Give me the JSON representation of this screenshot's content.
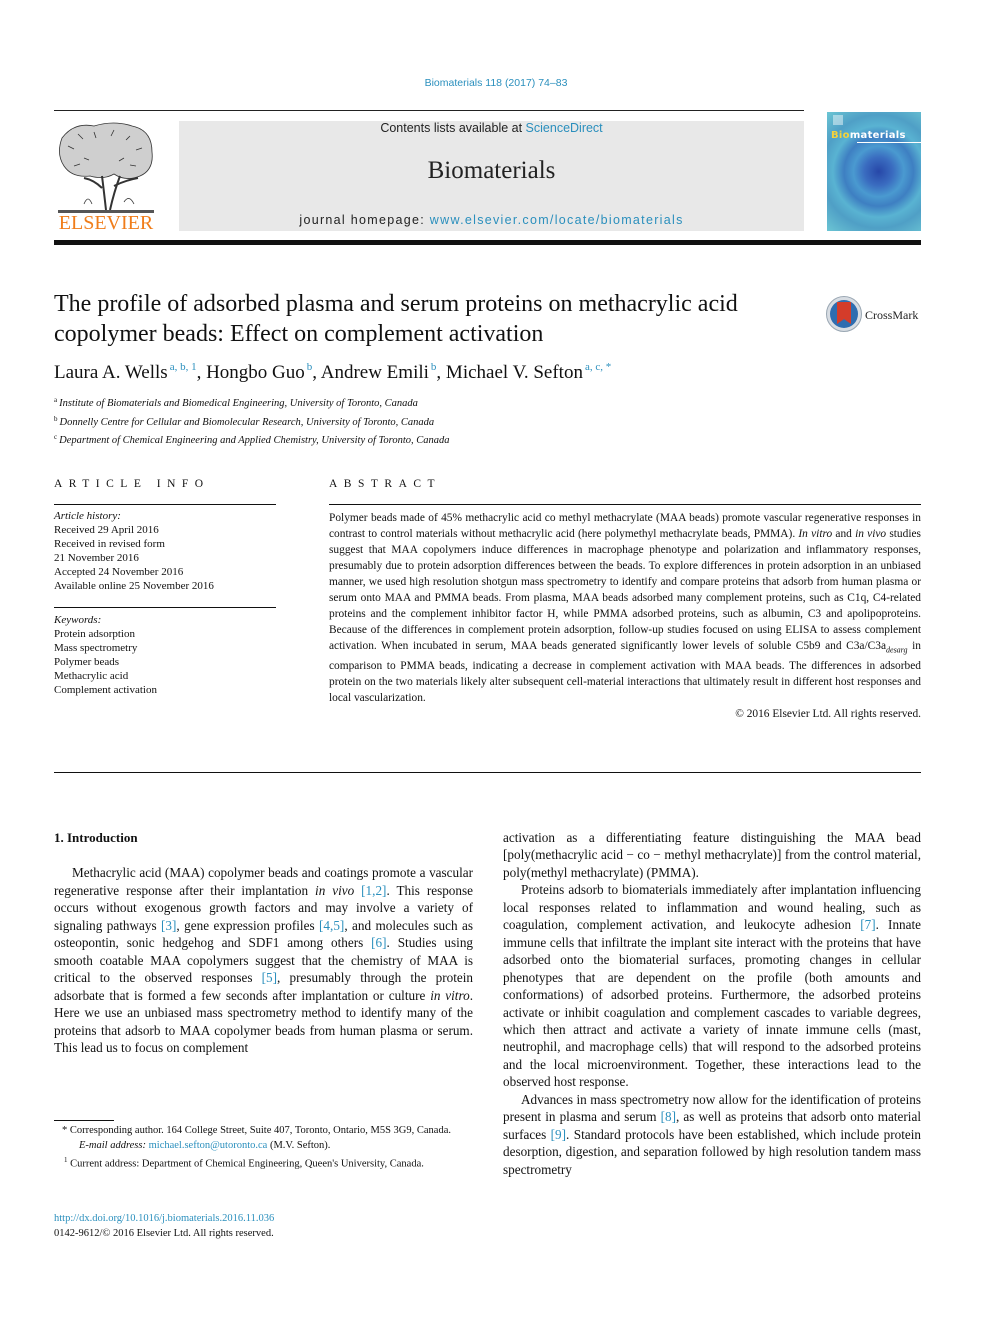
{
  "header": {
    "journal_ref": "Biomaterials 118 (2017) 74–83",
    "contents_prefix": "Contents lists available at ",
    "contents_link": "ScienceDirect",
    "journal_name": "Biomaterials",
    "homepage_prefix": "journal homepage: ",
    "homepage_link": "www.elsevier.com/locate/biomaterials",
    "publisher_logo_text": "ELSEVIER",
    "cover_title_bio": "Bio",
    "cover_title_rest": "materials",
    "colors": {
      "link": "#2a8fbd",
      "elsevier_orange": "#f07d1a",
      "masthead_bg": "#e8e8e8"
    }
  },
  "article": {
    "title": "The profile of adsorbed plasma and serum proteins on methacrylic acid copolymer beads: Effect on complement activation",
    "crossmark_label": "CrossMark",
    "authors": [
      {
        "name": "Laura A. Wells",
        "sup": "a, b, 1",
        "sep": ", "
      },
      {
        "name": "Hongbo Guo",
        "sup": "b",
        "sep": ", "
      },
      {
        "name": "Andrew Emili",
        "sup": "b",
        "sep": ", "
      },
      {
        "name": "Michael V. Sefton",
        "sup": "a, c, *",
        "sep": ""
      }
    ],
    "affiliations": [
      {
        "mark": "a",
        "text": "Institute of Biomaterials and Biomedical Engineering, University of Toronto, Canada"
      },
      {
        "mark": "b",
        "text": "Donnelly Centre for Cellular and Biomolecular Research, University of Toronto, Canada"
      },
      {
        "mark": "c",
        "text": "Department of Chemical Engineering and Applied Chemistry, University of Toronto, Canada"
      }
    ]
  },
  "article_info": {
    "heading": "ARTICLE INFO",
    "history_label": "Article history:",
    "history": [
      "Received 29 April 2016",
      "Received in revised form",
      "21 November 2016",
      "Accepted 24 November 2016",
      "Available online 25 November 2016"
    ],
    "keywords_label": "Keywords:",
    "keywords": [
      "Protein adsorption",
      "Mass spectrometry",
      "Polymer beads",
      "Methacrylic acid",
      "Complement activation"
    ]
  },
  "abstract": {
    "heading": "ABSTRACT",
    "part1": "Polymer beads made of 45% methacrylic acid co methyl methacrylate (MAA beads) promote vascular regenerative responses in contrast to control materials without methacrylic acid (here polymethyl methacrylate beads, PMMA). ",
    "in_vitro": "In vitro",
    "and": " and ",
    "in_vivo": "in vivo",
    "part2": " studies suggest that MAA copolymers induce differences in macrophage phenotype and polarization and inflammatory responses, presumably due to protein adsorption differences between the beads. To explore differences in protein adsorption in an unbiased manner, we used high resolution shotgun mass spectrometry to identify and compare proteins that adsorb from human plasma or serum onto MAA and PMMA beads. From plasma, MAA beads adsorbed many complement proteins, such as C1q, C4-related proteins and the complement inhibitor factor H, while PMMA adsorbed proteins, such as albumin, C3 and apolipoproteins. Because of the differences in complement protein adsorption, follow-up studies focused on using ELISA to assess complement activation. When incubated in serum, MAA beads generated significantly lower levels of soluble C5b9 and C3a/C3a",
    "sub": "desarg",
    "part3": " in comparison to PMMA beads, indicating a decrease in complement activation with MAA beads. The differences in adsorbed protein on the two materials likely alter subsequent cell-material interactions that ultimately result in different host responses and local vascularization.",
    "copyright": "© 2016 Elsevier Ltd. All rights reserved."
  },
  "intro": {
    "heading": "1.  Introduction",
    "p1": [
      {
        "t": "Methacrylic acid (MAA) copolymer beads and coatings promote a vascular regenerative response after their implantation "
      },
      {
        "i": "in vivo"
      },
      {
        "t": " "
      },
      {
        "ref": "[1,2]"
      },
      {
        "t": ". This response occurs without exogenous growth factors and may involve a variety of signaling pathways "
      },
      {
        "ref": "[3]"
      },
      {
        "t": ", gene expression profiles "
      },
      {
        "ref": "[4,5]"
      },
      {
        "t": ", and molecules such as osteopontin, sonic hedgehog and SDF1 among others "
      },
      {
        "ref": "[6]"
      },
      {
        "t": ". Studies using smooth coatable MAA copolymers suggest that the chemistry of MAA is critical to the observed responses "
      },
      {
        "ref": "[5]"
      },
      {
        "t": ", presumably through the protein adsorbate that is formed a few seconds after implantation or culture "
      },
      {
        "i": "in vitro"
      },
      {
        "t": ". Here we use an unbiased mass spectrometry method to identify many of the proteins that adsorb to MAA copolymer beads from human plasma or serum. This lead us to focus on complement"
      }
    ],
    "p1_cont": "activation as a differentiating feature distinguishing the MAA bead [poly(methacrylic acid − co − methyl methacrylate)] from the control material, poly(methyl methacrylate) (PMMA).",
    "p2": [
      {
        "t": "Proteins adsorb to biomaterials immediately after implantation influencing local responses related to inflammation and wound healing, such as coagulation, complement activation, and leukocyte adhesion "
      },
      {
        "ref": "[7]"
      },
      {
        "t": ". Innate immune cells that infiltrate the implant site interact with the proteins that have adsorbed onto the biomaterial surfaces, promoting changes in cellular phenotypes that are dependent on the profile (both amounts and conformations) of adsorbed proteins. Furthermore, the adsorbed proteins activate or inhibit coagulation and complement cascades to variable degrees, which then attract and activate a variety of innate immune cells (mast, neutrophil, and macrophage cells) that will respond to the adsorbed proteins and the local microenvironment. Together, these interactions lead to the observed host response."
      }
    ],
    "p3": [
      {
        "t": "Advances in mass spectrometry now allow for the identification of proteins present in plasma and serum "
      },
      {
        "ref": "[8]"
      },
      {
        "t": ", as well as proteins that adsorb onto material surfaces "
      },
      {
        "ref": "[9]"
      },
      {
        "t": ". Standard protocols have been established, which include protein desorption, digestion, and separation followed by high resolution tandem mass spectrometry"
      }
    ]
  },
  "footnotes": {
    "corresponding": "* Corresponding author. 164 College Street, Suite 407, Toronto, Ontario, M5S 3G9, Canada.",
    "email_label": "E-mail address: ",
    "email": "michael.sefton@utoronto.ca",
    "email_suffix": " (M.V. Sefton).",
    "current_mark": "1",
    "current": " Current address: Department of Chemical Engineering, Queen's University, Canada."
  },
  "doi": {
    "link": "http://dx.doi.org/10.1016/j.biomaterials.2016.11.036",
    "issn": "0142-9612/© 2016 Elsevier Ltd. All rights reserved."
  }
}
